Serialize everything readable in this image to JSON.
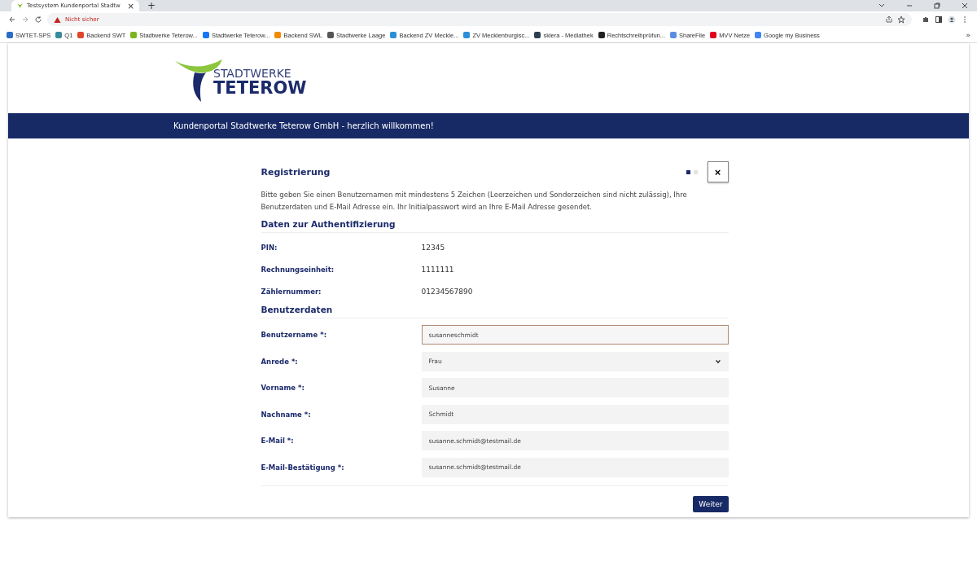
{
  "browser": {
    "tab_title": "Testsystem Kundenportal Stadtw",
    "tab_close": "×",
    "new_tab": "+",
    "security": "Nicht sicher",
    "bookmarks": [
      {
        "label": "SWTET-SPS",
        "color": "#2b6cc4"
      },
      {
        "label": "Q1",
        "color": "#3a8a9c"
      },
      {
        "label": "Backend SWT",
        "color": "#e0452b"
      },
      {
        "label": "Stadtwerke Teterow...",
        "color": "#7ab51d"
      },
      {
        "label": "Stadtwerke Teterow...",
        "color": "#1877f2"
      },
      {
        "label": "Backend SWL",
        "color": "#f28a00"
      },
      {
        "label": "Stadtwerke Laage",
        "color": "#555555"
      },
      {
        "label": "Backend ZV Meckle...",
        "color": "#2a8fd6"
      },
      {
        "label": "ZV Mecklenburgisc...",
        "color": "#2a8fd6"
      },
      {
        "label": "sklera - Mediathek",
        "color": "#2c3e50"
      },
      {
        "label": "Rechtschreibprüfun...",
        "color": "#222222"
      },
      {
        "label": "ShareFile",
        "color": "#5b8de0"
      },
      {
        "label": "MVV Netze",
        "color": "#e2001a"
      },
      {
        "label": "Google my Business",
        "color": "#4285f4"
      }
    ],
    "overflow": "»"
  },
  "logo": {
    "line1": "STADTWERKE",
    "line2": "TETEROW"
  },
  "banner": "Kundenportal Stadtwerke Teterow GmbH - herzlich willkommen!",
  "dialog": {
    "title": "Registrierung",
    "steps": [
      {
        "selected": true
      },
      {
        "selected": false
      }
    ],
    "close": "×",
    "intro": "Bitte geben Sie einen Benutzernamen mit mindestens 5 Zeichen (Leerzeichen und Sonderzeichen sind nicht zulässig), Ihre Benutzerdaten und E-Mail Adresse ein. Ihr Initialpasswort wird an Ihre E-Mail Adresse gesendet.",
    "auth": {
      "heading": "Daten zur Authentifizierung",
      "rows": [
        {
          "label": "PIN:",
          "value": "12345"
        },
        {
          "label": "Rechnungseinheit:",
          "value": "1111111"
        },
        {
          "label": "Zählernummer:",
          "value": "01234567890"
        }
      ]
    },
    "user": {
      "heading": "Benutzerdaten",
      "fields": [
        {
          "label": "Benutzername *:",
          "value": "susanneschmidt",
          "kind": "input",
          "focused": true
        },
        {
          "label": "Anrede *:",
          "value": "Frau",
          "kind": "select",
          "focused": false
        },
        {
          "label": "Vorname *:",
          "value": "Susanne",
          "kind": "input",
          "focused": false
        },
        {
          "label": "Nachname *:",
          "value": "Schmidt",
          "kind": "input",
          "focused": false
        },
        {
          "label": "E-Mail *:",
          "value": "susanne.schmidt@testmail.de",
          "kind": "input",
          "focused": false
        },
        {
          "label": "E-Mail-Bestätigung *:",
          "value": "susanne.schmidt@testmail.de",
          "kind": "input",
          "focused": false
        }
      ]
    },
    "next": "Weiter"
  }
}
